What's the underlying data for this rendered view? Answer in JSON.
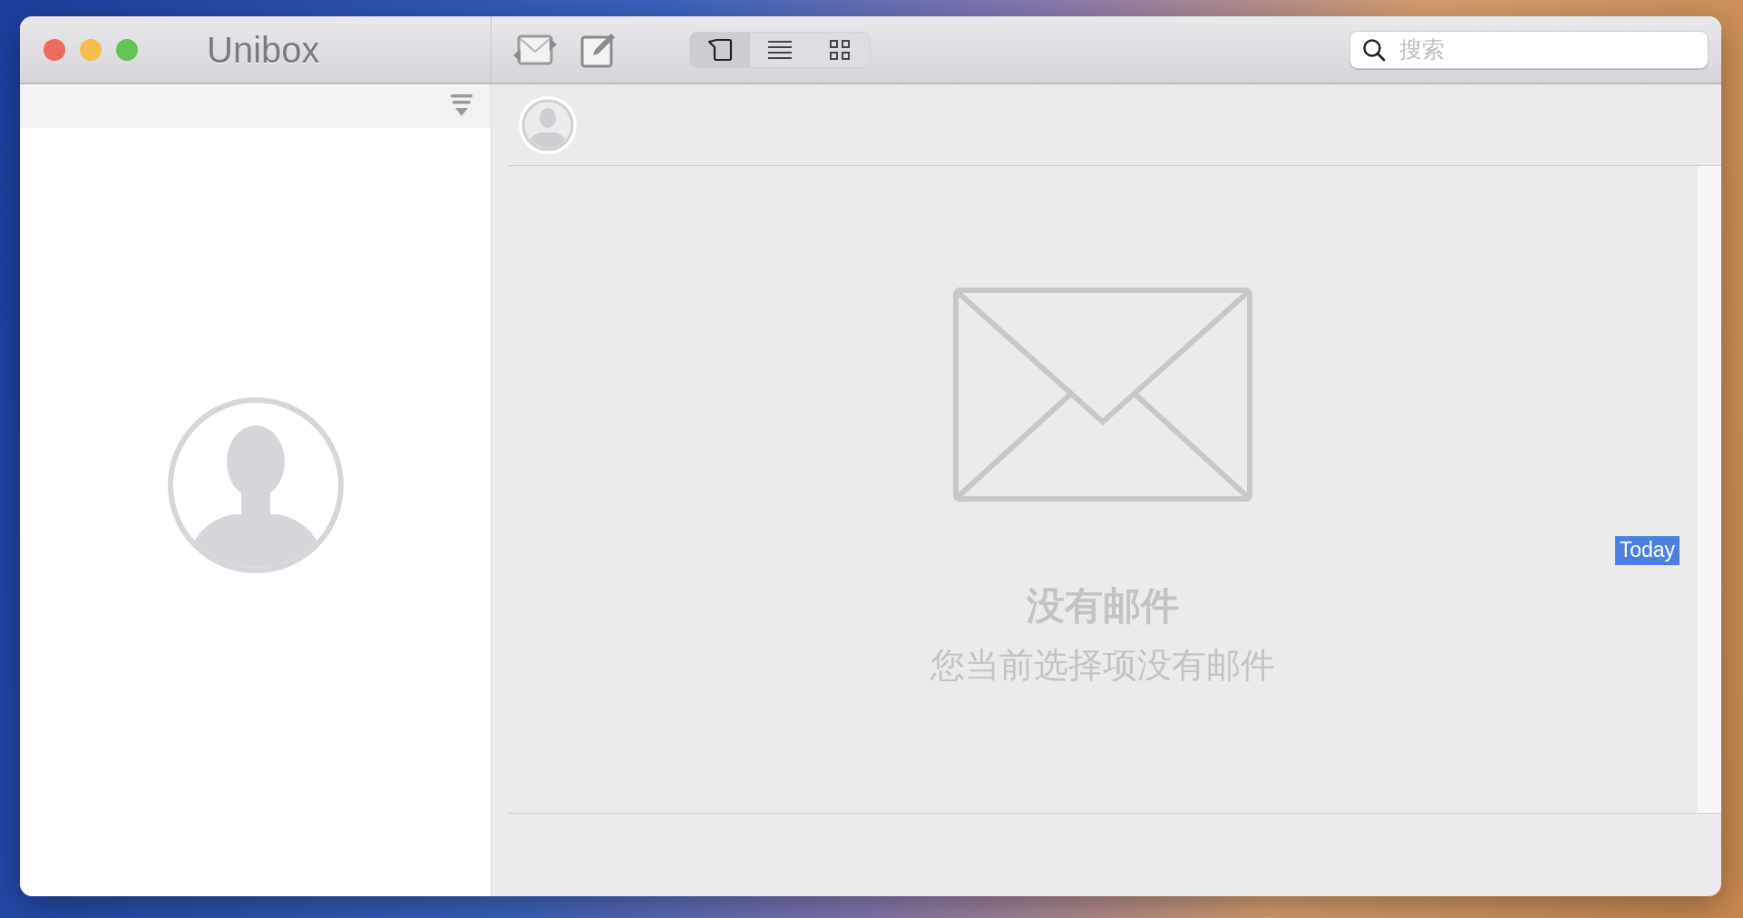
{
  "window": {
    "title": "Unibox"
  },
  "toolbar": {
    "buttons": [
      {
        "kind": "sync"
      },
      {
        "kind": "compose"
      }
    ],
    "view_segments": [
      {
        "kind": "bubble",
        "selected": true
      },
      {
        "kind": "list",
        "selected": false
      },
      {
        "kind": "grid",
        "selected": false
      }
    ]
  },
  "search": {
    "placeholder": "搜索"
  },
  "empty_state": {
    "title": "没有邮件",
    "subtitle": "您当前选择项没有邮件"
  },
  "date_label": "Today"
}
